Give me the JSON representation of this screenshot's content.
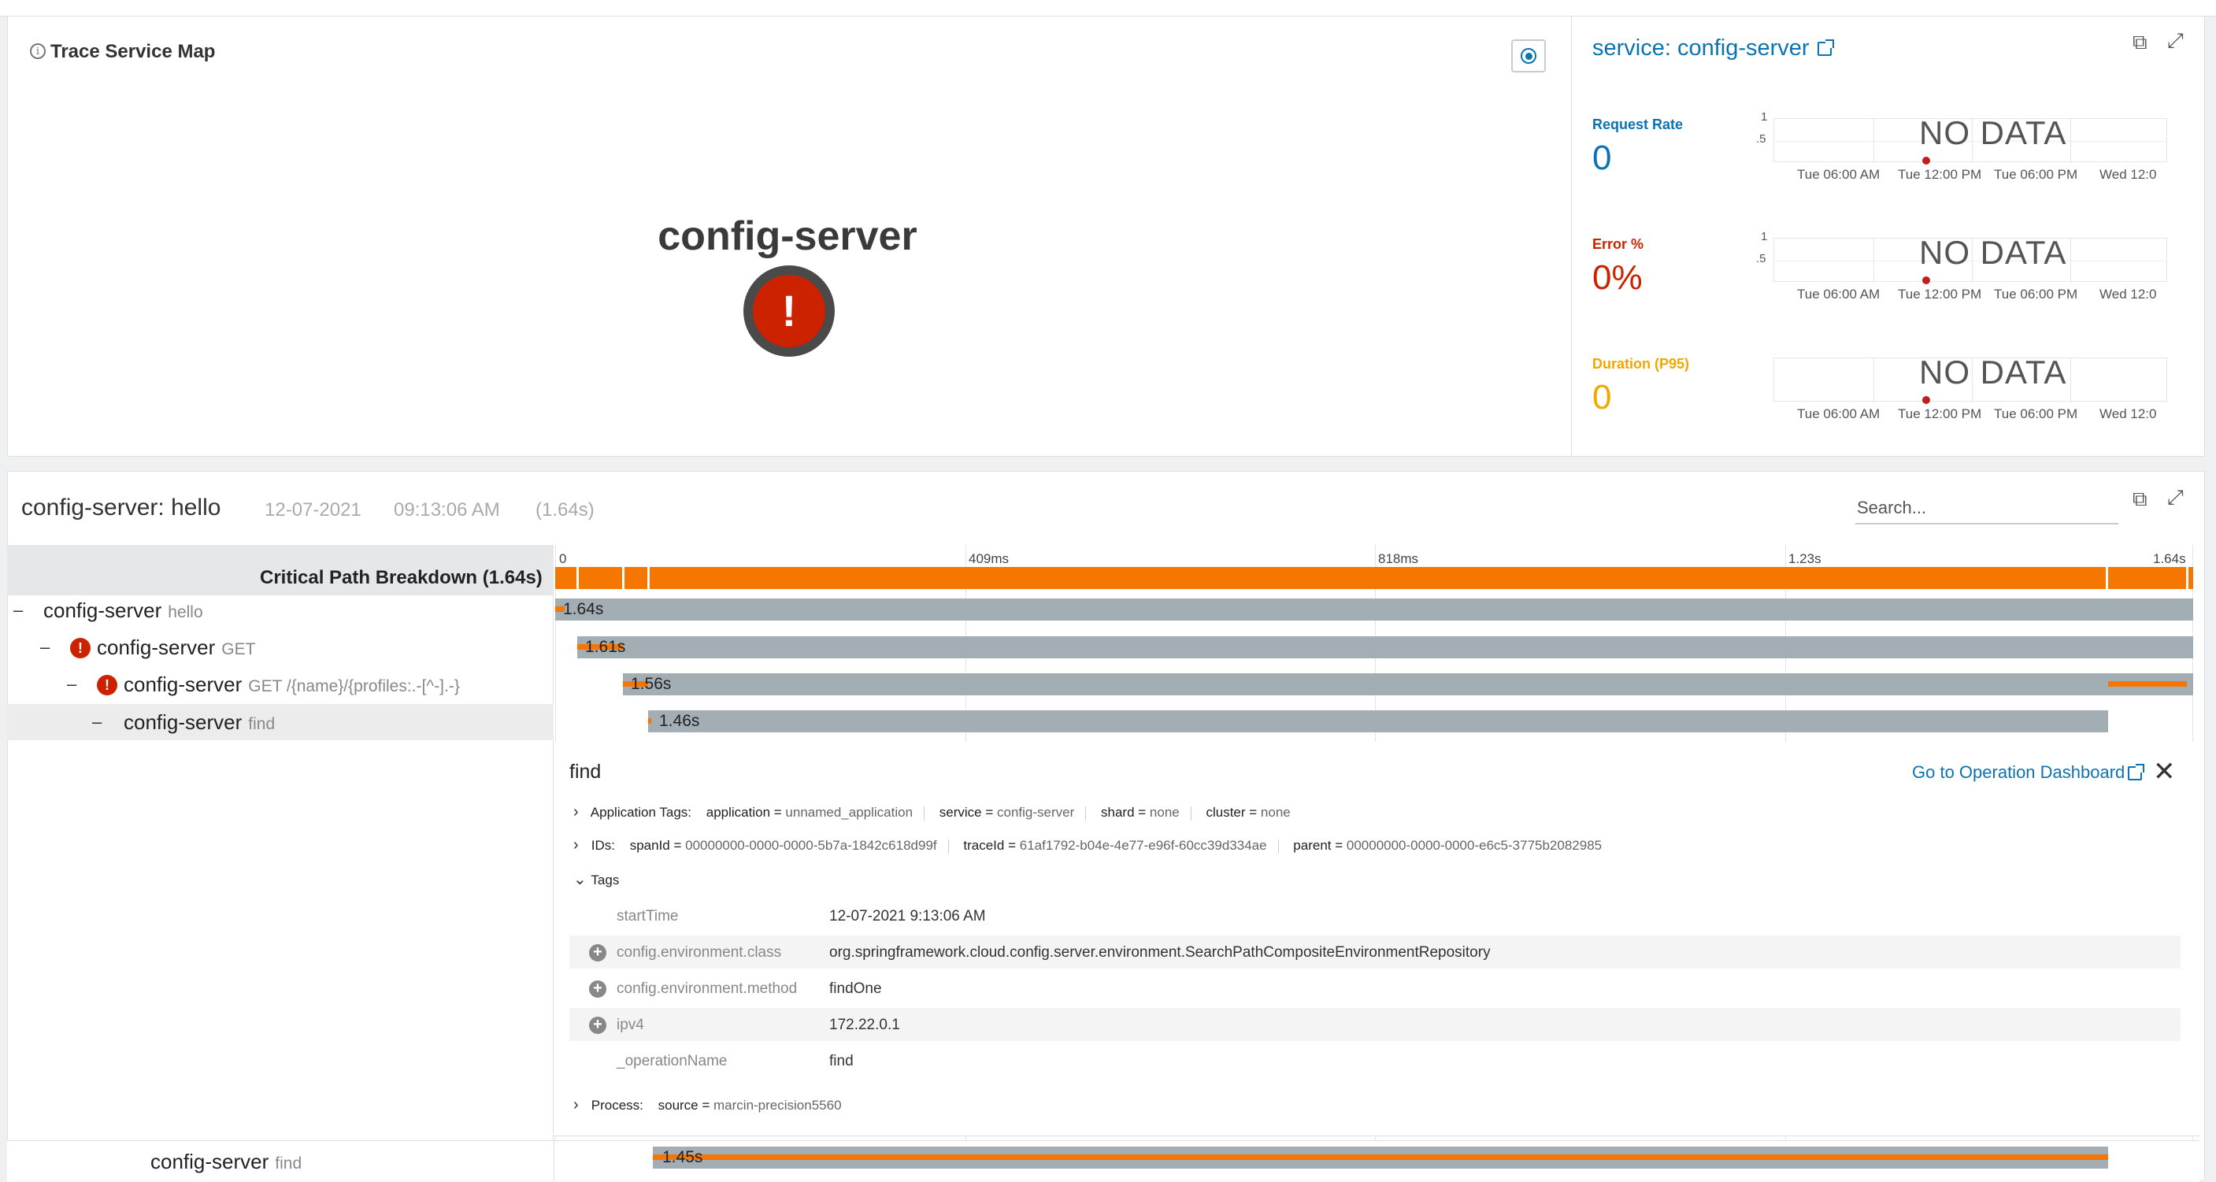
{
  "service_map": {
    "title": "Trace Service Map",
    "node_label": "config-server",
    "node_status": "error"
  },
  "service_panel": {
    "title": "service: config-server",
    "metrics": [
      {
        "label": "Request Rate",
        "value": "0",
        "color": "#0b73b3",
        "yticks": [
          "1",
          ".5"
        ],
        "nodata": "NO DATA"
      },
      {
        "label": "Error %",
        "value": "0%",
        "color": "#cc2200",
        "yticks": [
          "1",
          ".5"
        ],
        "nodata": "NO DATA"
      },
      {
        "label": "Duration (P95)",
        "value": "0",
        "color": "#f0a800",
        "yticks": [],
        "nodata": "NO DATA"
      }
    ],
    "x_ticks": [
      "Tue 06:00 AM",
      "Tue 12:00 PM",
      "Tue 06:00 PM",
      "Wed 12:0"
    ]
  },
  "trace": {
    "title": "config-server: hello",
    "date": "12-07-2021",
    "time": "09:13:06 AM",
    "duration": "(1.64s)",
    "search_placeholder": "Search...",
    "critical_path_label": "Critical Path Breakdown (1.64s)",
    "time_ticks": [
      "0",
      "409ms",
      "818ms",
      "1.23s",
      "1.64s"
    ],
    "spans": [
      {
        "toggle": "–",
        "service": "config-server",
        "operation": "hello",
        "error": false,
        "bar_label": "1.64s"
      },
      {
        "toggle": "–",
        "service": "config-server",
        "operation": "GET",
        "error": true,
        "bar_label": "1.61s"
      },
      {
        "toggle": "–",
        "service": "config-server",
        "operation": "GET /{name}/{profiles:.-[^-].-}",
        "error": true,
        "bar_label": "1.56s"
      },
      {
        "toggle": "–",
        "service": "config-server",
        "operation": "find",
        "error": false,
        "bar_label": "1.46s"
      }
    ],
    "last_span": {
      "service": "config-server",
      "operation": "find",
      "bar_label": "1.45s"
    }
  },
  "detail": {
    "title": "find",
    "dashboard_link": "Go to Operation Dashboard",
    "close_icon": "close-icon",
    "app_tags_label": "Application Tags:",
    "app_tags": [
      {
        "k": "application",
        "v": "unnamed_application"
      },
      {
        "k": "service",
        "v": "config-server"
      },
      {
        "k": "shard",
        "v": "none"
      },
      {
        "k": "cluster",
        "v": "none"
      }
    ],
    "ids_label": "IDs:",
    "ids": [
      {
        "k": "spanId",
        "v": "00000000-0000-0000-5b7a-1842c618d99f"
      },
      {
        "k": "traceId",
        "v": "61af1792-b04e-4e77-e96f-60cc39d334ae"
      },
      {
        "k": "parent",
        "v": "00000000-0000-0000-e6c5-3775b2082985"
      }
    ],
    "tags_label": "Tags",
    "tags": [
      {
        "k": "startTime",
        "v": "12-07-2021 9:13:06 AM",
        "plus": false
      },
      {
        "k": "config.environment.class",
        "v": "org.springframework.cloud.config.server.environment.SearchPathCompositeEnvironmentRepository",
        "plus": true
      },
      {
        "k": "config.environment.method",
        "v": "findOne",
        "plus": true
      },
      {
        "k": "ipv4",
        "v": "172.22.0.1",
        "plus": true
      },
      {
        "k": "_operationName",
        "v": "find",
        "plus": false
      }
    ],
    "process_label": "Process:",
    "process": [
      {
        "k": "source",
        "v": "marcin-precision5560"
      }
    ]
  }
}
